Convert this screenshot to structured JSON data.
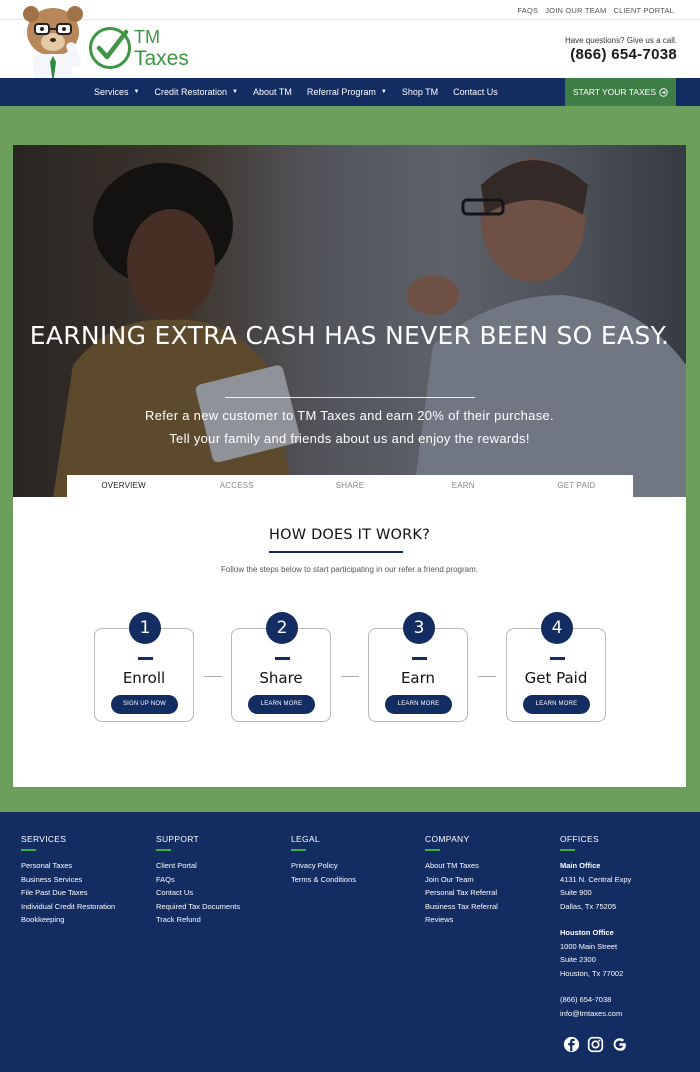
{
  "topbar": {
    "links": [
      "FAQS",
      "JOIN OUR TEAM",
      "CLIENT PORTAL"
    ]
  },
  "brand": {
    "logo_line1": "TM",
    "logo_line2": "Taxes"
  },
  "header_contact": {
    "question": "Have questions? Give us a call.",
    "phone": "(866) 654-7038"
  },
  "nav": {
    "items": [
      {
        "label": "Services",
        "dropdown": true
      },
      {
        "label": "Credit Restoration",
        "dropdown": true
      },
      {
        "label": "About TM",
        "dropdown": false
      },
      {
        "label": "Referral Program",
        "dropdown": true
      },
      {
        "label": "Shop TM",
        "dropdown": false
      },
      {
        "label": "Contact Us",
        "dropdown": false
      }
    ],
    "cta": "START YOUR TAXES"
  },
  "hero": {
    "heading": "EARNING EXTRA CASH HAS NEVER BEEN SO EASY.",
    "sub1": "Refer a new customer to TM Taxes and earn 20% of their purchase.",
    "sub2": "Tell your family and friends about us and enjoy the rewards!"
  },
  "tabs": [
    "OVERVIEW",
    "ACCESS",
    "SHARE",
    "EARN",
    "GET PAID"
  ],
  "tabs_active": 0,
  "how": {
    "title": "HOW DOES IT WORK?",
    "description": "Follow the steps below to start participating in our refer a friend program."
  },
  "steps": [
    {
      "number": "1",
      "label": "Enroll",
      "button": "SIGN UP NOW"
    },
    {
      "number": "2",
      "label": "Share",
      "button": "LEARN MORE"
    },
    {
      "number": "3",
      "label": "Earn",
      "button": "LEARN MORE"
    },
    {
      "number": "4",
      "label": "Get Paid",
      "button": "LEARN MORE"
    }
  ],
  "footer": {
    "services": {
      "title": "SERVICES",
      "links": [
        "Personal Taxes",
        "Business Services",
        "File Past Due Taxes",
        "Individual Credit Restoration",
        "Bookkeeping"
      ]
    },
    "support": {
      "title": "SUPPORT",
      "links": [
        "Client Portal",
        "FAQs",
        "Contact Us",
        "Required Tax Documents",
        "Track Refund"
      ]
    },
    "legal": {
      "title": "LEGAL",
      "links": [
        "Privacy Policy",
        "Terms & Conditions"
      ]
    },
    "company": {
      "title": "COMPANY",
      "links": [
        "About TM Taxes",
        "Join Our Team",
        "Personal Tax Referral",
        "Business Tax Referral",
        "Reviews"
      ]
    },
    "offices": {
      "title": "OFFICES",
      "main_title": "Main Office",
      "main_lines": [
        "4131 N. Central Expy",
        "Suite 900",
        "Dallas, Tx 75205"
      ],
      "houston_title": "Houston Office",
      "houston_lines": [
        "1000 Main Street",
        "Suite 2300",
        "Houston, Tx 77002"
      ],
      "phone": "(866) 654-7038",
      "email": "info@tmtaxes.com"
    },
    "social": [
      "facebook-icon",
      "instagram-icon",
      "google-icon"
    ]
  },
  "colors": {
    "navy": "#132c62",
    "green": "#6c9f5b",
    "cta_green": "#3e7d45",
    "logo_green": "#3f9544",
    "accent_line": "#3fae49"
  }
}
